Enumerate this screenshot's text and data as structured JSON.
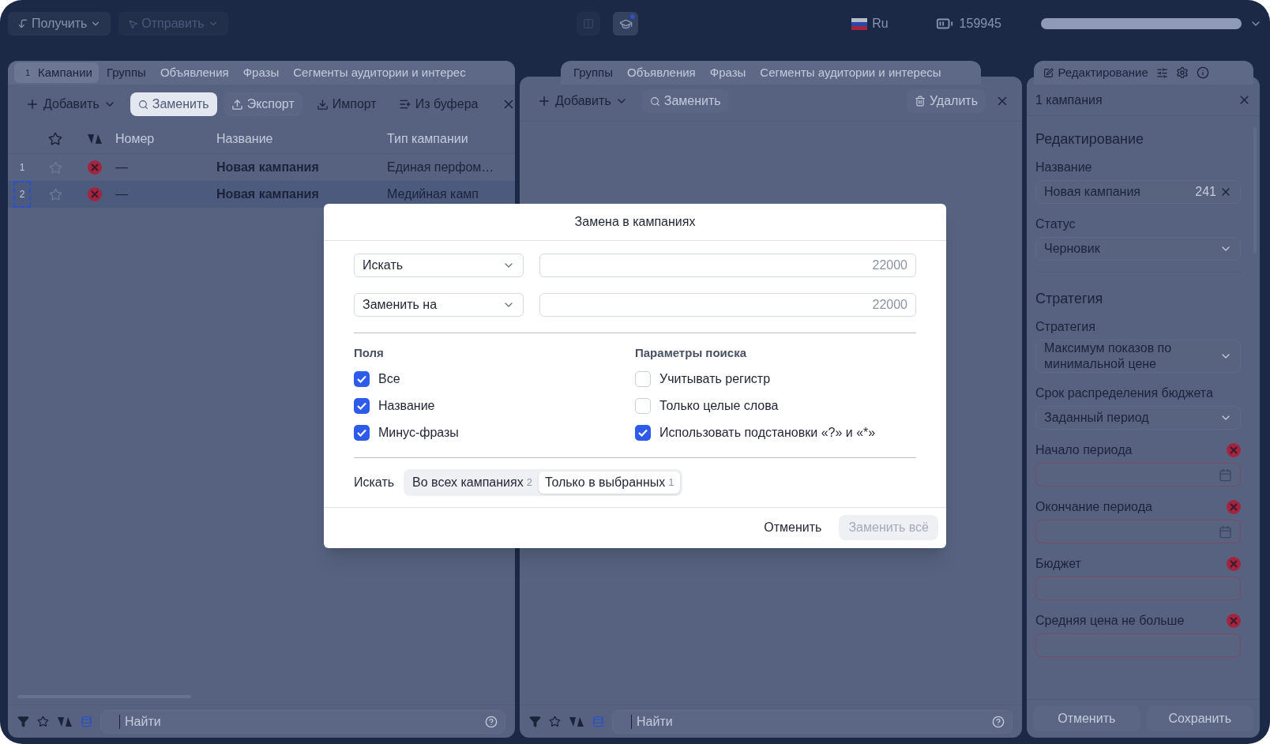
{
  "top_bar": {
    "get_button": "Получить",
    "send_button": "Отправить",
    "language": "Ru",
    "balance": "159945"
  },
  "left_panel": {
    "tabs": [
      {
        "label": "Кампании",
        "badge": "1",
        "selected": true,
        "disabled": false
      },
      {
        "label": "Группы",
        "selected": false,
        "disabled": false
      },
      {
        "label": "Объявления",
        "selected": false,
        "disabled": true
      },
      {
        "label": "Фразы",
        "selected": false,
        "disabled": true
      },
      {
        "label": "Сегменты аудитории и интерес",
        "selected": false,
        "disabled": true
      }
    ],
    "toolbar": [
      {
        "kind": "add",
        "label": "Добавить",
        "disabled": false,
        "active": false
      },
      {
        "kind": "replace",
        "label": "Заменить",
        "disabled": false,
        "active": true
      },
      {
        "kind": "export",
        "label": "Экспорт",
        "disabled": true,
        "active": false
      },
      {
        "kind": "import",
        "label": "Импорт",
        "disabled": false,
        "active": false
      },
      {
        "kind": "buffer",
        "label": "Из буфера",
        "disabled": false,
        "active": false
      }
    ],
    "columns": [
      "Номер",
      "Название",
      "Тип кампании"
    ],
    "rows": [
      {
        "index": "1",
        "number": "—",
        "name": "Новая кампания",
        "type": "Единая перфом…",
        "selected": false
      },
      {
        "index": "2",
        "number": "—",
        "name": "Новая кампания",
        "type": "Медийная камп",
        "selected": true
      }
    ],
    "search": {
      "placeholder": "Найти"
    }
  },
  "middle_panel": {
    "tabs": [
      {
        "label": "Группы",
        "selected": false,
        "disabled": false
      },
      {
        "label": "Объявления",
        "selected": false,
        "disabled": true
      },
      {
        "label": "Фразы",
        "selected": false,
        "disabled": true
      },
      {
        "label": "Сегменты аудитории и интересы",
        "selected": false,
        "disabled": true
      }
    ],
    "toolbar": [
      {
        "kind": "add",
        "label": "Добавить",
        "disabled": false,
        "active": false
      },
      {
        "kind": "replace",
        "label": "Заменить",
        "disabled": true,
        "active": false
      },
      {
        "kind": "delete",
        "label": "Удалить",
        "disabled": true,
        "active": false
      }
    ],
    "search": {
      "placeholder": "Найти"
    }
  },
  "right_panel": {
    "tab": "Редактирование",
    "header": "1 кампания",
    "sections": [
      {
        "title": "Редактирование",
        "fields": [
          {
            "kind": "text",
            "label": "Название",
            "value": "Новая кампания",
            "counter": "241",
            "error": false
          },
          {
            "kind": "select",
            "label": "Статус",
            "value": "Черновик",
            "error": false
          }
        ]
      },
      {
        "title": "Стратегия",
        "fields": [
          {
            "kind": "select",
            "label": "Стратегия",
            "value": "Максимум показов по минимальной цене",
            "error": false
          },
          {
            "kind": "select",
            "label": "Срок распределения бюджета",
            "value": "Заданный период",
            "error": false
          },
          {
            "kind": "date",
            "label": "Начало периода",
            "error": true
          },
          {
            "kind": "date",
            "label": "Окончание периода",
            "error": true
          },
          {
            "kind": "text",
            "label": "Бюджет",
            "error": true
          },
          {
            "kind": "text",
            "label": "Средняя цена не больше",
            "error": true
          }
        ]
      }
    ],
    "buttons": [
      {
        "label": "Отменить",
        "disabled": true
      },
      {
        "label": "Сохранить",
        "disabled": true
      }
    ]
  },
  "dialog": {
    "title": "Замена в кампаниях",
    "rows": [
      {
        "select": "Искать",
        "counter": "22000"
      },
      {
        "select": "Заменить на",
        "counter": "22000"
      }
    ],
    "groups": [
      {
        "title": "Поля",
        "options": [
          {
            "label": "Все",
            "checked": true
          },
          {
            "label": "Название",
            "checked": true
          },
          {
            "label": "Минус-фразы",
            "checked": true
          }
        ]
      },
      {
        "title": "Параметры поиска",
        "options": [
          {
            "label": "Учитывать регистр",
            "checked": false
          },
          {
            "label": "Только целые слова",
            "checked": false
          },
          {
            "label": "Использовать подстановки «?» и «*»",
            "checked": true
          }
        ]
      }
    ],
    "scope": {
      "label": "Искать",
      "options": [
        {
          "label": "Во всех кампаниях",
          "count": "2",
          "selected": false
        },
        {
          "label": "Только в выбранных",
          "count": "1",
          "selected": true
        }
      ]
    },
    "buttons": [
      {
        "label": "Отменить",
        "disabled": false
      },
      {
        "label": "Заменить всё",
        "disabled": true
      }
    ]
  }
}
